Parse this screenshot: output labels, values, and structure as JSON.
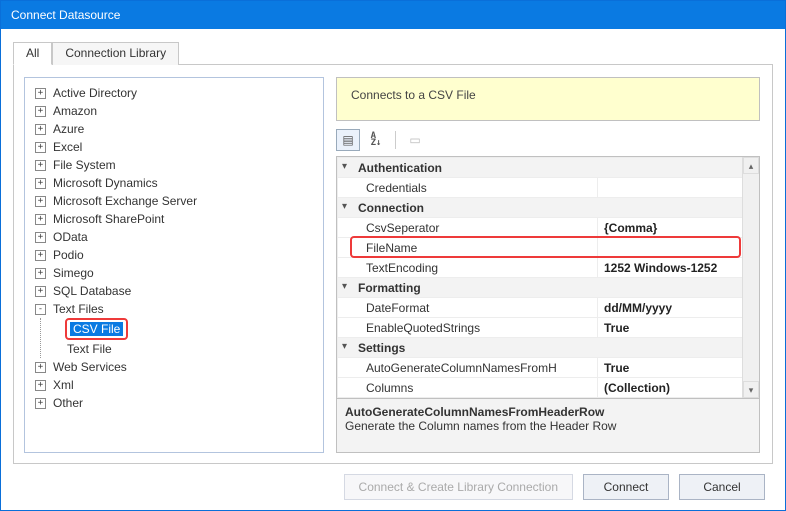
{
  "window": {
    "title": "Connect Datasource"
  },
  "tabs": {
    "all": "All",
    "lib": "Connection Library"
  },
  "tree": {
    "nodes": [
      {
        "id": "ad",
        "label": "Active Directory",
        "exp": "+"
      },
      {
        "id": "amz",
        "label": "Amazon",
        "exp": "+"
      },
      {
        "id": "azure",
        "label": "Azure",
        "exp": "+"
      },
      {
        "id": "excel",
        "label": "Excel",
        "exp": "+"
      },
      {
        "id": "fs",
        "label": "File System",
        "exp": "+"
      },
      {
        "id": "msdyn",
        "label": "Microsoft Dynamics",
        "exp": "+"
      },
      {
        "id": "msex",
        "label": "Microsoft Exchange Server",
        "exp": "+"
      },
      {
        "id": "mssp",
        "label": "Microsoft SharePoint",
        "exp": "+"
      },
      {
        "id": "odata",
        "label": "OData",
        "exp": "+"
      },
      {
        "id": "podio",
        "label": "Podio",
        "exp": "+"
      },
      {
        "id": "simego",
        "label": "Simego",
        "exp": "+"
      },
      {
        "id": "sql",
        "label": "SQL Database",
        "exp": "+"
      },
      {
        "id": "txt",
        "label": "Text Files",
        "exp": "-"
      },
      {
        "id": "ws",
        "label": "Web Services",
        "exp": "+"
      },
      {
        "id": "xml",
        "label": "Xml",
        "exp": "+"
      },
      {
        "id": "other",
        "label": "Other",
        "exp": "+"
      }
    ],
    "txt_children": [
      {
        "id": "csv",
        "label": "CSV File",
        "selected": true
      },
      {
        "id": "txtf",
        "label": "Text File"
      }
    ]
  },
  "description": "Connects to a CSV File",
  "props": {
    "categories": {
      "auth": "Authentication",
      "conn": "Connection",
      "fmt": "Formatting",
      "set": "Settings"
    },
    "rows": {
      "credentials": {
        "name": "Credentials",
        "val": ""
      },
      "csvsep": {
        "name": "CsvSeperator",
        "val": "{Comma}"
      },
      "filename": {
        "name": "FileName",
        "val": ""
      },
      "textenc": {
        "name": "TextEncoding",
        "val": "1252    Windows-1252"
      },
      "datefmt": {
        "name": "DateFormat",
        "val": "dd/MM/yyyy"
      },
      "enq": {
        "name": "EnableQuotedStrings",
        "val": "True"
      },
      "agen": {
        "name": "AutoGenerateColumnNamesFromH",
        "val": "True"
      },
      "cols": {
        "name": "Columns",
        "val": "(Collection)"
      }
    },
    "footer": {
      "head": "AutoGenerateColumnNamesFromHeaderRow",
      "body": "Generate the Column names from the Header Row"
    }
  },
  "buttons": {
    "createlib": "Connect & Create Library Connection",
    "connect": "Connect",
    "cancel": "Cancel"
  }
}
